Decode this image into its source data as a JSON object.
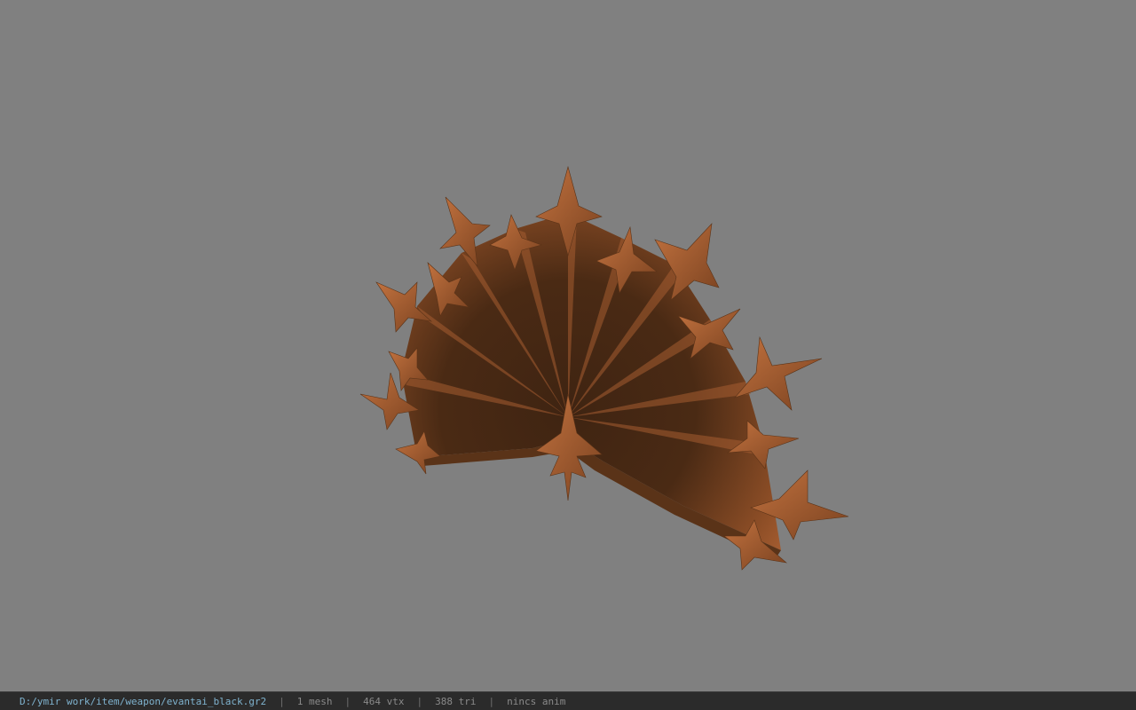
{
  "viewport": {
    "background_color": "#808080",
    "model_color_light": "#b8693a",
    "model_color_dark": "#3f2412"
  },
  "status_bar": {
    "file_path": "D:/ymir work/item/weapon/evantai_black.gr2",
    "separator": "|",
    "meshes": "1 mesh",
    "vertices": "464 vtx",
    "triangles": "388 tri",
    "animation": "nincs anim"
  }
}
